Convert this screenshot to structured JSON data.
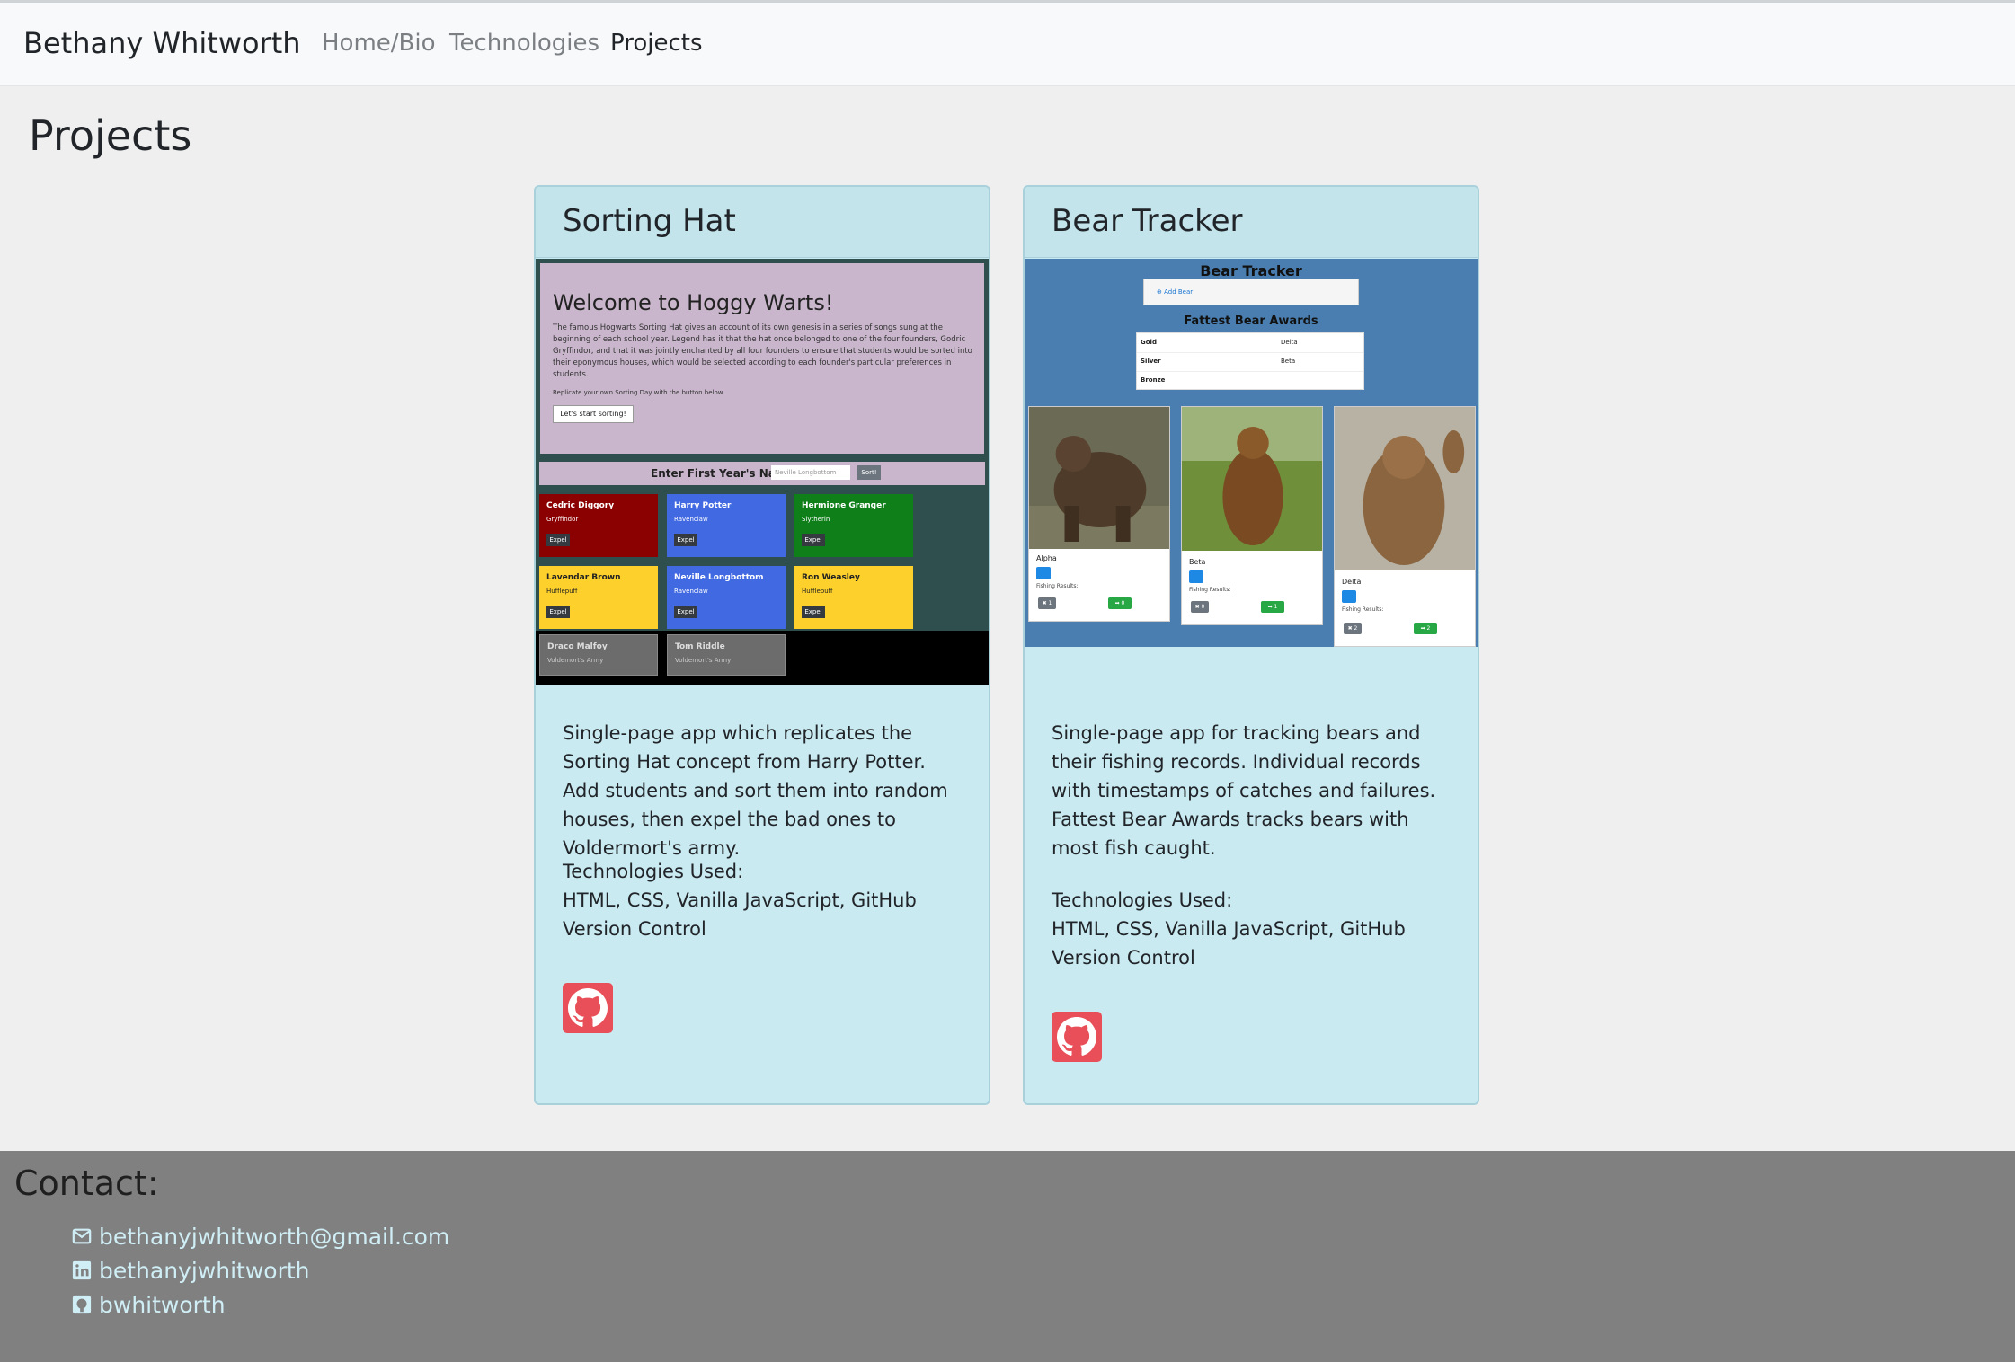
{
  "brand": "Bethany Whitworth",
  "nav": {
    "home": "Home/Bio",
    "technologies": "Technologies",
    "projects": "Projects"
  },
  "page_title": "Projects",
  "projects": [
    {
      "title": "Sorting Hat",
      "description": "Single-page app which replicates the Sorting Hat concept from Harry Potter. Add students and sort them into random houses, then expel the bad ones to Voldermort's army.",
      "tech_label": "Technologies Used:",
      "tech_list": "HTML, CSS, Vanilla JavaScript, GitHub Version Control",
      "github_icon": "github-icon",
      "screenshot": {
        "heading": "Welcome to Hoggy Warts!",
        "paragraph": "The famous Hogwarts Sorting Hat gives an account of its own genesis in a series of songs sung at the beginning of each school year. Legend has it that the hat once belonged to one of the four founders, Godric Gryffindor, and that it was jointly enchanted by all four founders to ensure that students would be sorted into their eponymous houses, which would be selected according to each founder's particular preferences in students.",
        "note": "Replicate your own Sorting Day with the button below.",
        "start_button": "Let's start sorting!",
        "form_label": "Enter First Year's Name",
        "input_placeholder": "Neville Longbottom",
        "sort_button": "Sort!",
        "expel_label": "Expel",
        "students": [
          {
            "name": "Cedric Diggory",
            "house": "Gryffindor",
            "color": "#8b0000"
          },
          {
            "name": "Harry Potter",
            "house": "Ravenclaw",
            "color": "#4169e1"
          },
          {
            "name": "Hermione Granger",
            "house": "Slytherin",
            "color": "#0f7f1a"
          },
          {
            "name": "Lavendar Brown",
            "house": "Hufflepuff",
            "color": "#fdd02b"
          },
          {
            "name": "Neville Longbottom",
            "house": "Ravenclaw",
            "color": "#4169e1"
          },
          {
            "name": "Ron Weasley",
            "house": "Hufflepuff",
            "color": "#fdd02b"
          }
        ],
        "army": [
          {
            "name": "Draco Malfoy",
            "house": "Voldemort's Army"
          },
          {
            "name": "Tom Riddle",
            "house": "Voldemort's Army"
          }
        ]
      }
    },
    {
      "title": "Bear Tracker",
      "description": "Single-page app for tracking bears and their fishing records. Individual records with timestamps of catches and failures. Fattest Bear Awards tracks bears with most fish caught.",
      "tech_label": "Technologies Used:",
      "tech_list": "HTML, CSS, Vanilla JavaScript, GitHub Version Control",
      "github_icon": "github-icon",
      "screenshot": {
        "title": "Bear Tracker",
        "add_button": "Add Bear",
        "awards_title": "Fattest Bear Awards",
        "awards": [
          {
            "place": "Gold",
            "winner": "Delta"
          },
          {
            "place": "Silver",
            "winner": "Beta"
          },
          {
            "place": "Bronze",
            "winner": ""
          }
        ],
        "fishing_label": "Fishing Results:",
        "bears": [
          {
            "name": "Alpha",
            "fails": "✖ 1",
            "catches": "➡ 0"
          },
          {
            "name": "Beta",
            "fails": "✖ 0",
            "catches": "➡ 1"
          },
          {
            "name": "Delta",
            "fails": "✖ 2",
            "catches": "➡ 2"
          }
        ]
      }
    }
  ],
  "contact": {
    "title": "Contact:",
    "email": "bethanyjwhitworth@gmail.com",
    "linkedin": "bethanyjwhitworth",
    "github": "bwhitworth",
    "icons": [
      "envelope-icon",
      "linkedin-icon",
      "github-icon"
    ]
  },
  "colors": {
    "card_bg": "#c9eaf1",
    "github_button": "#e84f58",
    "footer_bg": "#808080",
    "contact_link": "#cfeef5"
  }
}
